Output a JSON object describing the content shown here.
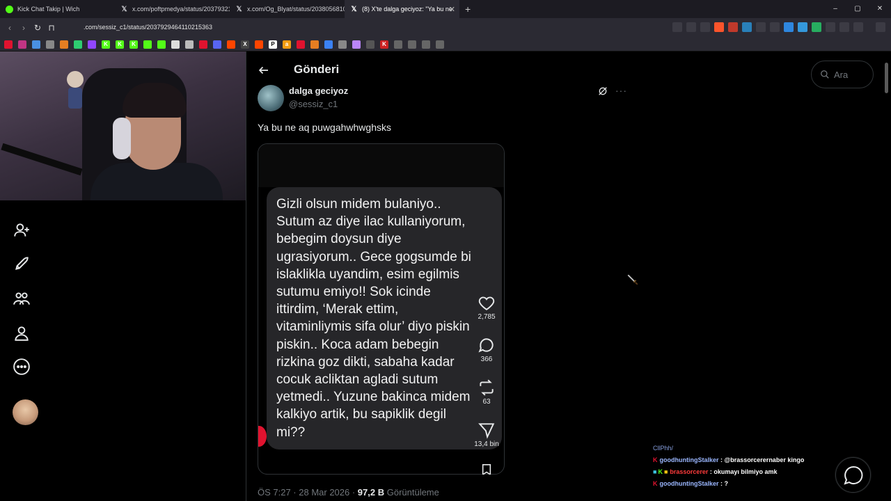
{
  "browser": {
    "tabs": [
      {
        "title": "Kick Chat Takip | Wich",
        "favicon": "kick-favicon"
      },
      {
        "title": "x.com/poftpmedya/status/203793211",
        "favicon": "x-favicon"
      },
      {
        "title": "x.com/Og_Blyat/status/20380568104",
        "favicon": "x-favicon"
      },
      {
        "title": "(8) X'te dalga geciyoz: \"Ya bu ne",
        "favicon": "x-favicon",
        "active": true
      }
    ],
    "new_tab_label": "+",
    "window_controls": [
      "–",
      "▢",
      "✕"
    ],
    "url": ".com/sessiz_c1/status/2037929464110215363",
    "bookmark_letters": [
      "",
      "",
      "",
      "",
      "",
      "",
      "",
      "K",
      "K",
      "K",
      "",
      "",
      "",
      "",
      "",
      "",
      "",
      "X",
      "",
      "P",
      "a",
      "",
      "",
      "",
      "",
      "",
      "",
      "K",
      "",
      "",
      "",
      ""
    ]
  },
  "page": {
    "header_title": "Gönderi",
    "search_placeholder": "Ara"
  },
  "post": {
    "author_name": "dalga geciyoz",
    "author_handle": "@sessiz_c1",
    "text": "Ya bu ne aq puwgahwhwghsks",
    "image_text": "Gizli olsun midem bulaniyo..\nSutum az diye ilac kullaniyorum,\nbebegim doysun diye\nugrasiyorum.. Gece gogsumde bi\nislaklikla uyandim, esim egilmis\nsutumu emiyo!! Sok icinde\nittirdim, ‘Merak ettim,\nvitaminliymis sifa olur’ diyo piskin\npiskin.. Koca adam bebegin\nrizkina goz dikti, sabaha kadar\ncocuk acliktan agladi sutum\nyetmedi.. Yuzune bakinca midem\nkalkiyo artik, bu sapiklik degil\nmi??",
    "likes": "2,785",
    "replies": "366",
    "reposts": "63",
    "shares": "13,4 bin",
    "time": "ÖS 7:27 · 28 Mar 2026 · ",
    "views_count": "97,2 B",
    "views_label": " Görüntüleme"
  },
  "chat": {
    "prev_line": "CllPhh/",
    "messages": [
      {
        "user": "goodhuntingStalker",
        "sep": " : ",
        "text": "@brassorcerernaber kingo"
      },
      {
        "user": "brassorcerer",
        "sep": " : ",
        "text": "okumayı bilmiyo amk"
      },
      {
        "user": "goodhuntingStalker",
        "sep": " : ",
        "text": "?"
      }
    ]
  },
  "colors": {
    "accent": "#1d9bf0",
    "kick_red": "#e0132f",
    "text": "#e7e9ea",
    "muted": "#71767b"
  }
}
